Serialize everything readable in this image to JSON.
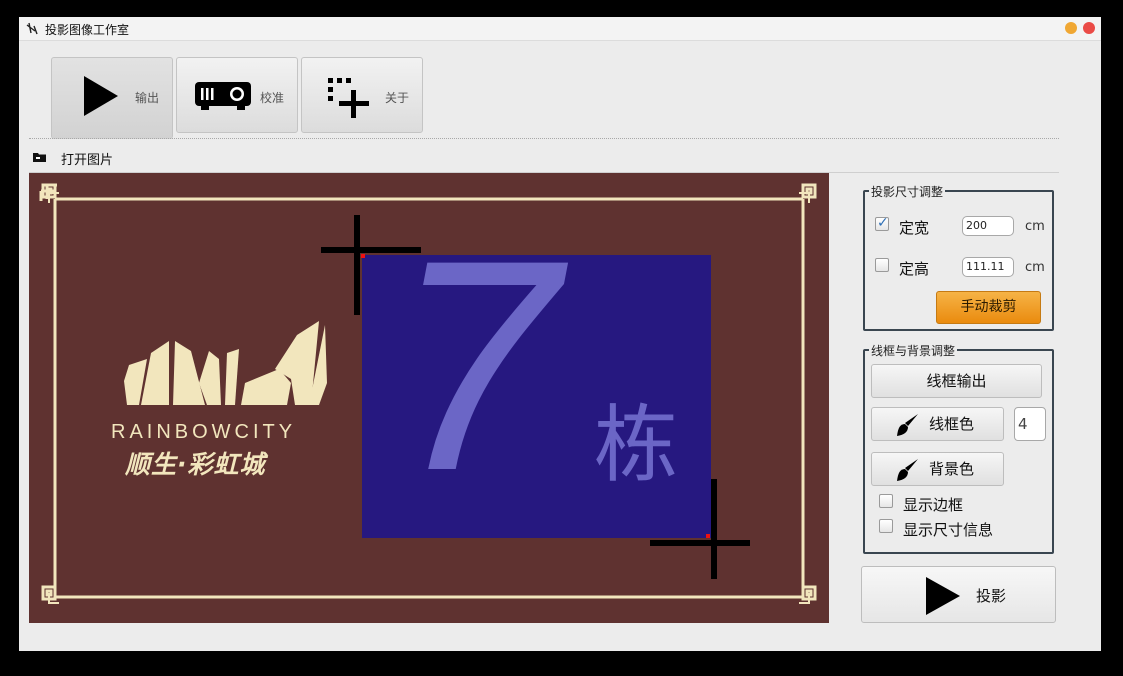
{
  "window": {
    "title": "投影图像工作室"
  },
  "tabs": [
    {
      "label": "输出",
      "icon": "play-icon",
      "active": true
    },
    {
      "label": "校准",
      "icon": "projector-icon",
      "active": false
    },
    {
      "label": "关于",
      "icon": "about-icon",
      "active": false
    }
  ],
  "toolbar": {
    "open_image_label": "打开图片"
  },
  "canvas": {
    "logo_latin": "RAINBOWCITY",
    "logo_chinese": "顺生·彩虹城",
    "big_number": "7",
    "building_char": "栋",
    "colors": {
      "background": "#5f3230",
      "frame": "#f2e6bd",
      "overlay": "#261880",
      "number": "#6b66c6"
    }
  },
  "size_panel": {
    "title": "投影尺寸调整",
    "fixed_width_label": "定宽",
    "fixed_width_checked": true,
    "width_value": "200",
    "fixed_height_label": "定高",
    "fixed_height_checked": false,
    "height_value": "111.11",
    "unit": "cm",
    "crop_button": "手动裁剪"
  },
  "frame_panel": {
    "title": "线框与背景调整",
    "wireframe_output_button": "线框输出",
    "wire_color_button": "线框色",
    "wire_width_value": "4",
    "bg_color_button": "背景色",
    "show_border_label": "显示边框",
    "show_border_checked": false,
    "show_size_info_label": "显示尺寸信息",
    "show_size_info_checked": false
  },
  "project_button": "投影"
}
